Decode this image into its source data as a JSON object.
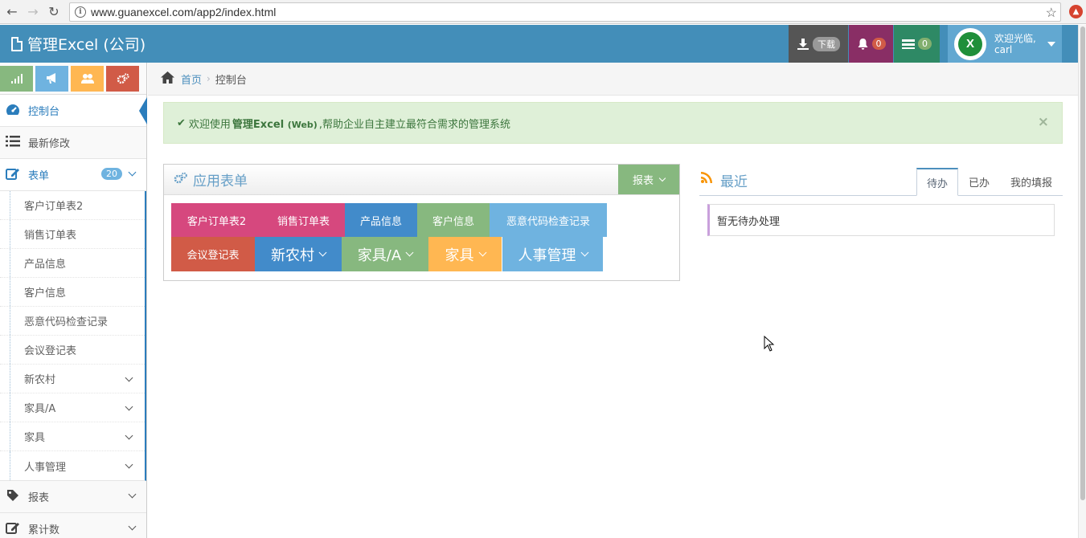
{
  "browser": {
    "url": "www.guanexcel.com/app2/index.html"
  },
  "navbar": {
    "brand": "管理Excel (公司)",
    "download_label": "下载",
    "notifications_count": "0",
    "messages_count": "0",
    "user_greeting": "欢迎光临,",
    "user_name": "carl"
  },
  "sidebar": {
    "items": [
      {
        "label": "控制台",
        "icon": "dashboard-icon"
      },
      {
        "label": "最新修改",
        "icon": "list-icon"
      },
      {
        "label": "表单",
        "icon": "edit-icon",
        "badge": "20"
      }
    ],
    "subitems": [
      {
        "label": "客户订单表2"
      },
      {
        "label": "销售订单表"
      },
      {
        "label": "产品信息"
      },
      {
        "label": "客户信息"
      },
      {
        "label": "恶意代码检查记录"
      },
      {
        "label": "会议登记表"
      },
      {
        "label": "新农村"
      },
      {
        "label": "家具/A"
      },
      {
        "label": "家具"
      },
      {
        "label": "人事管理"
      }
    ],
    "bottom_items": [
      {
        "label": "报表",
        "icon": "tag-icon"
      },
      {
        "label": "累计数",
        "icon": "edit-icon"
      }
    ]
  },
  "breadcrumbs": {
    "home": "首页",
    "current": "控制台"
  },
  "alert": {
    "prefix": "欢迎使用",
    "highlight": "管理Excel",
    "highlight_small": "(Web)",
    "suffix": ",帮助企业自主建立最符合需求的管理系统"
  },
  "apps_widget": {
    "title": "应用表单",
    "report_button": "报表",
    "tiles": [
      {
        "label": "客户订单表2",
        "color": "#d6487e"
      },
      {
        "label": "销售订单表",
        "color": "#d6487e"
      },
      {
        "label": "产品信息",
        "color": "#428bca"
      },
      {
        "label": "客户信息",
        "color": "#87b87f"
      },
      {
        "label": "恶意代码检查记录",
        "color": "#6fb3e0"
      },
      {
        "label": "会议登记表",
        "color": "#d15b47"
      },
      {
        "label": "新农村",
        "color": "#428bca"
      },
      {
        "label": "家具/A",
        "color": "#87b87f"
      },
      {
        "label": "家具",
        "color": "#ffb752"
      },
      {
        "label": "人事管理",
        "color": "#6fb3e0"
      }
    ]
  },
  "recent_widget": {
    "title": "最近",
    "tabs": [
      "待办",
      "已办",
      "我的填报"
    ],
    "empty_text": "暂无待办处理"
  }
}
